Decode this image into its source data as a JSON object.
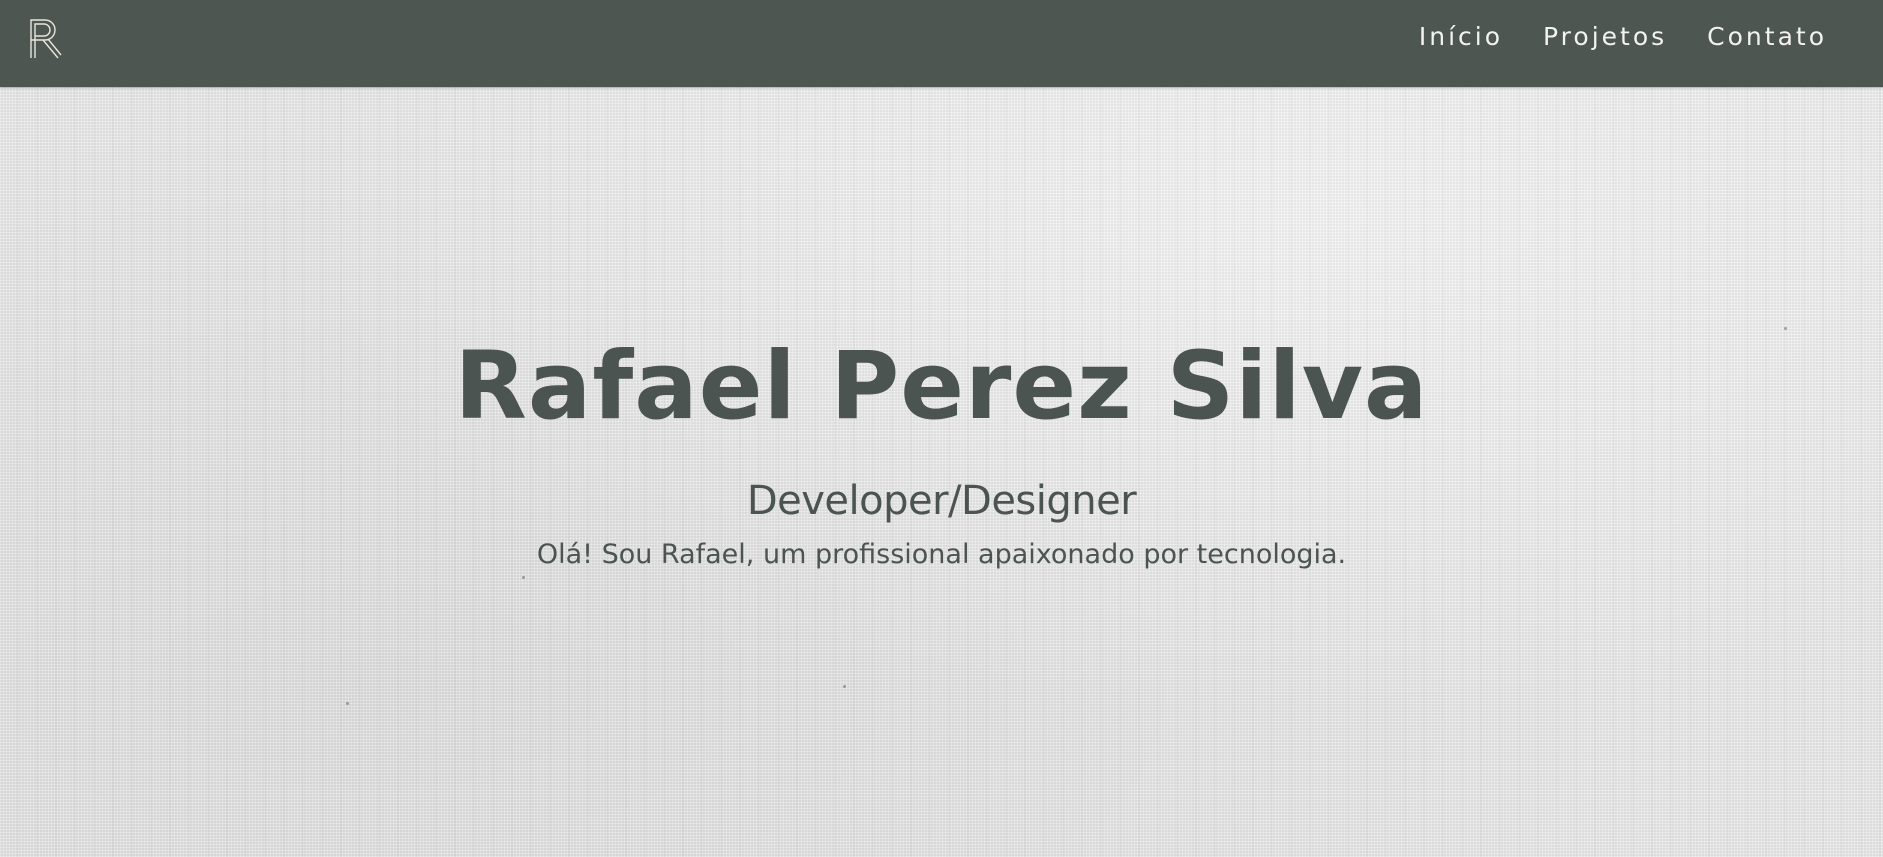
{
  "header": {
    "logo_icon": "rp-monogram-logo",
    "background_color": "#4d5651",
    "text_color": "#f2f2ef",
    "nav": [
      {
        "label": "Início"
      },
      {
        "label": "Projetos"
      },
      {
        "label": "Contato"
      }
    ]
  },
  "hero": {
    "name": "Rafael Perez Silva",
    "role": "Developer/Designer",
    "intro": "Olá! Sou Rafael, um profissional apaixonado por tecnologia.",
    "text_color": "#4b5450",
    "background": "light gray linen texture"
  }
}
